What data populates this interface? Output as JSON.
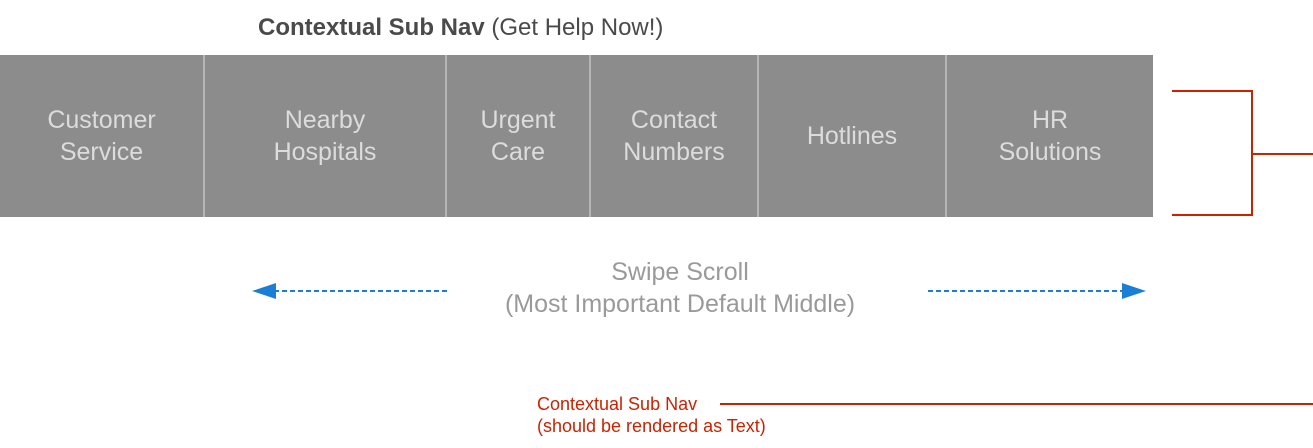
{
  "header": {
    "title_bold": "Contextual Sub Nav",
    "title_rest": "(Get Help Now!)"
  },
  "nav": {
    "items": [
      {
        "line1": "Customer",
        "line2": "Service"
      },
      {
        "line1": "Nearby",
        "line2": "Hospitals"
      },
      {
        "line1": "Urgent",
        "line2": "Care"
      },
      {
        "line1": "Contact",
        "line2": "Numbers"
      },
      {
        "line1": "Hotlines",
        "line2": ""
      },
      {
        "line1": "HR",
        "line2": "Solutions"
      }
    ]
  },
  "swipe": {
    "line1": "Swipe Scroll",
    "line2": "(Most Important Default Middle)"
  },
  "annotation": {
    "line1": "Contextual Sub Nav",
    "line2": "(should be rendered as Text)"
  },
  "colors": {
    "nav_bg": "#8c8c8c",
    "nav_text": "#dcdcdc",
    "arrow": "#1a7fd4",
    "annotation": "#cc2200"
  }
}
